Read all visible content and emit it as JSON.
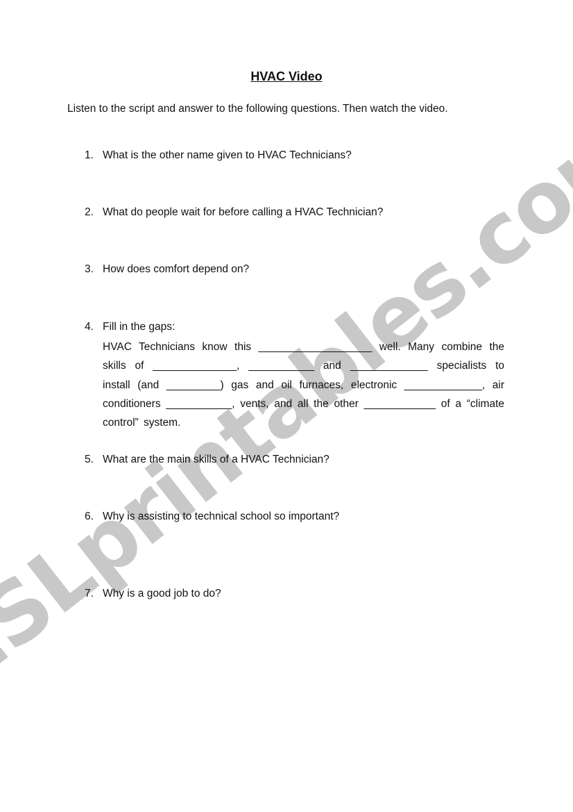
{
  "document": {
    "title": "HVAC Video",
    "intro": "Listen to the script and answer to the following questions. Then watch the video.",
    "questions": [
      {
        "number": "1.",
        "text": "What is the other name given to HVAC Technicians?"
      },
      {
        "number": "2.",
        "text": "What do people wait for before calling a HVAC Technician?"
      },
      {
        "number": "3.",
        "text": "How does comfort depend on?"
      },
      {
        "number": "4.",
        "text": "Fill in the gaps:"
      },
      {
        "number": "5.",
        "text": "What are the main skills of a HVAC Technician?"
      },
      {
        "number": "6.",
        "text": "Why is assisting to technical school so important?"
      },
      {
        "number": "7.",
        "text": "Why is a good job to do?"
      }
    ],
    "gap_fill": "HVAC Technicians know this ___________________ well. Many combine the skills of ______________, ___________ and _____________ specialists to install (and _________) gas and oil furnaces, electronic _____________, air conditioners ___________, vents, and all the other ____________ of a “climate control” system."
  },
  "watermark": {
    "text": "ESLprintables.com",
    "color": "#c8c8c8"
  }
}
